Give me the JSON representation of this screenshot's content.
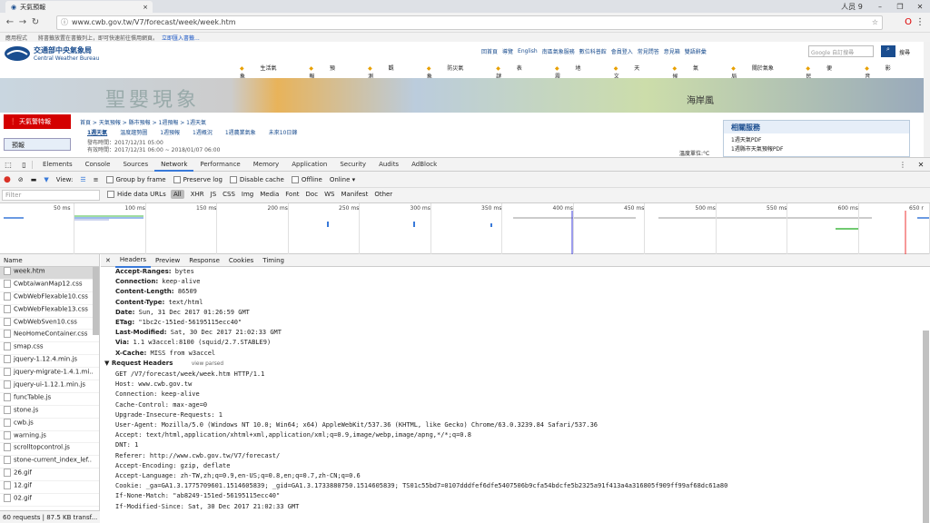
{
  "browser": {
    "tab_title": "天氣預報",
    "profile": "人员 9",
    "url": "www.cwb.gov.tw/V7/forecast/week/week.htm",
    "bookmarks_hint": "應用程式",
    "bookmarks_text": "將書籤放置在書籤列上，即可快速前往慣用網頁。",
    "bookmarks_link": "立即匯入書籤..."
  },
  "site": {
    "org_name": "交通部中央氣象局",
    "org_en": "Central Weather Bureau",
    "top_links": [
      "回首頁",
      "導覽",
      "English",
      "南區氣象服務",
      "數位科普館",
      "會員登入",
      "常見問答",
      "意見箱",
      "雙語辭彙"
    ],
    "search_placeholder": "Google 自訂搜尋",
    "search_label": "搜尋",
    "nav": [
      "生活氣象",
      "預報",
      "觀測",
      "防災氣象",
      "表謎",
      "地震",
      "天文",
      "氣候",
      "關於氣象局",
      "便民",
      "影音"
    ],
    "banner_left": "聖嬰現象",
    "banner_right": "海岸風",
    "alert": "天氣警特報",
    "side_menu": "預報",
    "breadcrumb": "首頁 > 天氣預報 > 縣市預報 > 1週預報 > 1週天氣",
    "subtabs": [
      "1週天氣",
      "溫度趨勢圖",
      "1週預報",
      "1週概況",
      "1週農業氣象",
      "未來10日鋒"
    ],
    "publish_time": "發布時間：2017/12/31 05:00",
    "valid_time": "有效時間：2017/12/31 06:00 ~ 2018/01/07 06:00",
    "unit_label": "溫度單位:°C",
    "related_title": "相關服務",
    "related_items": [
      "1週天氣PDF",
      "1週縣市天氣預報PDF"
    ]
  },
  "devtools": {
    "tabs": [
      "Elements",
      "Console",
      "Sources",
      "Network",
      "Performance",
      "Memory",
      "Application",
      "Security",
      "Audits",
      "AdBlock"
    ],
    "active_tab": "Network",
    "view_label": "View:",
    "group_by_frame": "Group by frame",
    "preserve_log": "Preserve log",
    "disable_cache": "Disable cache",
    "offline": "Offline",
    "throttle": "Online",
    "filter_placeholder": "Filter",
    "hide_data_urls": "Hide data URLs",
    "filter_types": [
      "All",
      "XHR",
      "JS",
      "CSS",
      "Img",
      "Media",
      "Font",
      "Doc",
      "WS",
      "Manifest",
      "Other"
    ],
    "timeline_ticks": [
      "50 ms",
      "100 ms",
      "150 ms",
      "200 ms",
      "250 ms",
      "300 ms",
      "350 ms",
      "400 ms",
      "450 ms",
      "500 ms",
      "550 ms",
      "600 ms",
      "650 r"
    ],
    "name_header": "Name",
    "requests": [
      "week.htm",
      "CwbtaiwanMap12.css",
      "CwbWebFlexable10.css",
      "CwbWebFlexable13.css",
      "CwbWebSven10.css",
      "NeoHomeContainer.css",
      "smap.css",
      "jquery-1.12.4.min.js",
      "jquery-migrate-1.4.1.mi..",
      "jquery-ui-1.12.1.min.js",
      "funcTable.js",
      "stone.js",
      "cwb.js",
      "warning.js",
      "scrolltopcontrol.js",
      "stone-current_index_lef..",
      "26.gif",
      "12.gif",
      "02.gif"
    ],
    "status": "60 requests | 87.5 KB transf...",
    "detail_tabs": [
      "Headers",
      "Preview",
      "Response",
      "Cookies",
      "Timing"
    ],
    "response_headers": [
      [
        "Accept-Ranges:",
        "bytes"
      ],
      [
        "Connection:",
        "keep-alive"
      ],
      [
        "Content-Length:",
        "86509"
      ],
      [
        "Content-Type:",
        "text/html"
      ],
      [
        "Date:",
        "Sun, 31 Dec 2017 01:26:59 GMT"
      ],
      [
        "ETag:",
        "\"1bc2c-151ed-56195115ecc40\""
      ],
      [
        "Last-Modified:",
        "Sat, 30 Dec 2017 21:02:33 GMT"
      ],
      [
        "Via:",
        "1.1 w3accel:8100 (squid/2.7.STABLE9)"
      ],
      [
        "X-Cache:",
        "MISS from w3accel"
      ]
    ],
    "request_headers_title": "Request Headers",
    "view_parsed": "view parsed",
    "request_lines": [
      "GET /V7/forecast/week/week.htm HTTP/1.1",
      "Host: www.cwb.gov.tw",
      "Connection: keep-alive",
      "Cache-Control: max-age=0",
      "Upgrade-Insecure-Requests: 1",
      "User-Agent: Mozilla/5.0 (Windows NT 10.0; Win64; x64) AppleWebKit/537.36 (KHTML, like Gecko) Chrome/63.0.3239.84 Safari/537.36",
      "Accept: text/html,application/xhtml+xml,application/xml;q=0.9,image/webp,image/apng,*/*;q=0.8",
      "DNT: 1",
      "Referer: http://www.cwb.gov.tw/V7/forecast/",
      "Accept-Encoding: gzip, deflate",
      "Accept-Language: zh-TW,zh;q=0.9,en-US;q=0.8,en;q=0.7,zh-CN;q=0.6",
      "Cookie: _ga=GA1.3.1775709601.1514605839; _gid=GA1.3.1733880750.1514605839; TS01c55bd7=0107dddfef6dfe5407506b9cfa54bdcfe5b2325a91f413a4a316805f909ff99af68dc61a80",
      "If-None-Match: \"ab8249-151ed-56195115ecc40\"",
      "If-Modified-Since: Sat, 30 Dec 2017 21:02:33 GMT"
    ]
  }
}
